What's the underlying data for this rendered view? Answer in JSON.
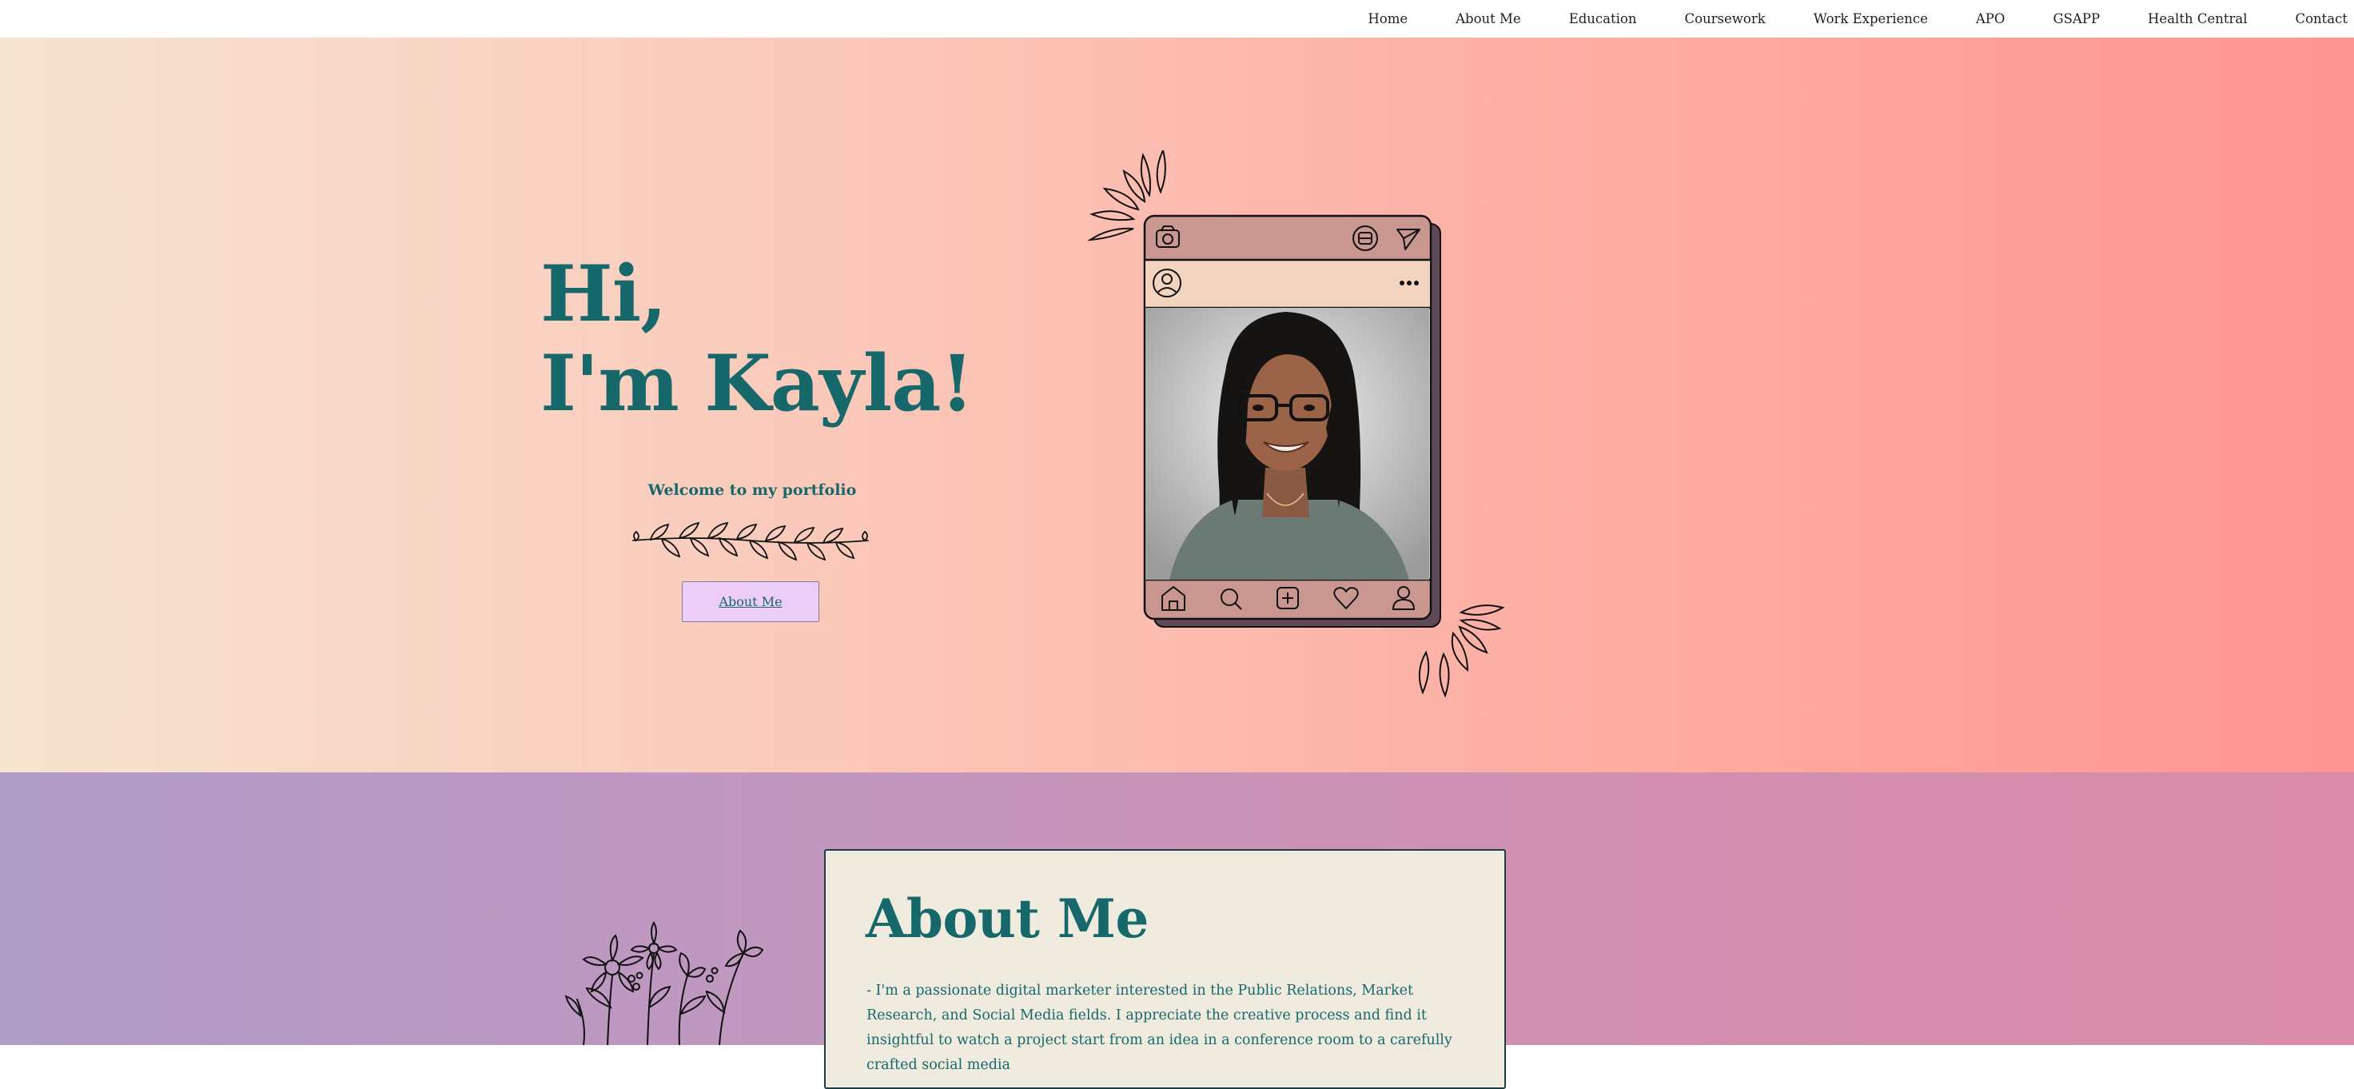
{
  "nav": {
    "items": [
      "Home",
      "About Me",
      "Education",
      "Coursework",
      "Work Experience",
      "APO",
      "GSAPP",
      "Health Central",
      "Contact"
    ]
  },
  "hero": {
    "greeting_line1": "Hi,",
    "greeting_line2": "I'm Kayla!",
    "welcome": "Welcome to my portfolio",
    "button_label": "About Me"
  },
  "about": {
    "title": "About Me",
    "text": "- I'm a passionate digital marketer interested in the Public Relations, Market Research, and Social Media fields. I appreciate the creative process and find it insightful to watch a project start from an idea in a conference room to a carefully crafted social media"
  },
  "colors": {
    "accent_teal": "#17686b",
    "button_bg": "#ebcdf8",
    "card_bg": "#efebde",
    "phone_header": "#c99690",
    "phone_subheader": "#f3d5bf"
  },
  "icons": [
    "camera-icon",
    "messenger-icon",
    "send-icon",
    "profile-icon",
    "more-icon",
    "home-icon",
    "search-icon",
    "add-post-icon",
    "heart-icon",
    "user-icon",
    "vine-ornament",
    "flower-illustration"
  ]
}
